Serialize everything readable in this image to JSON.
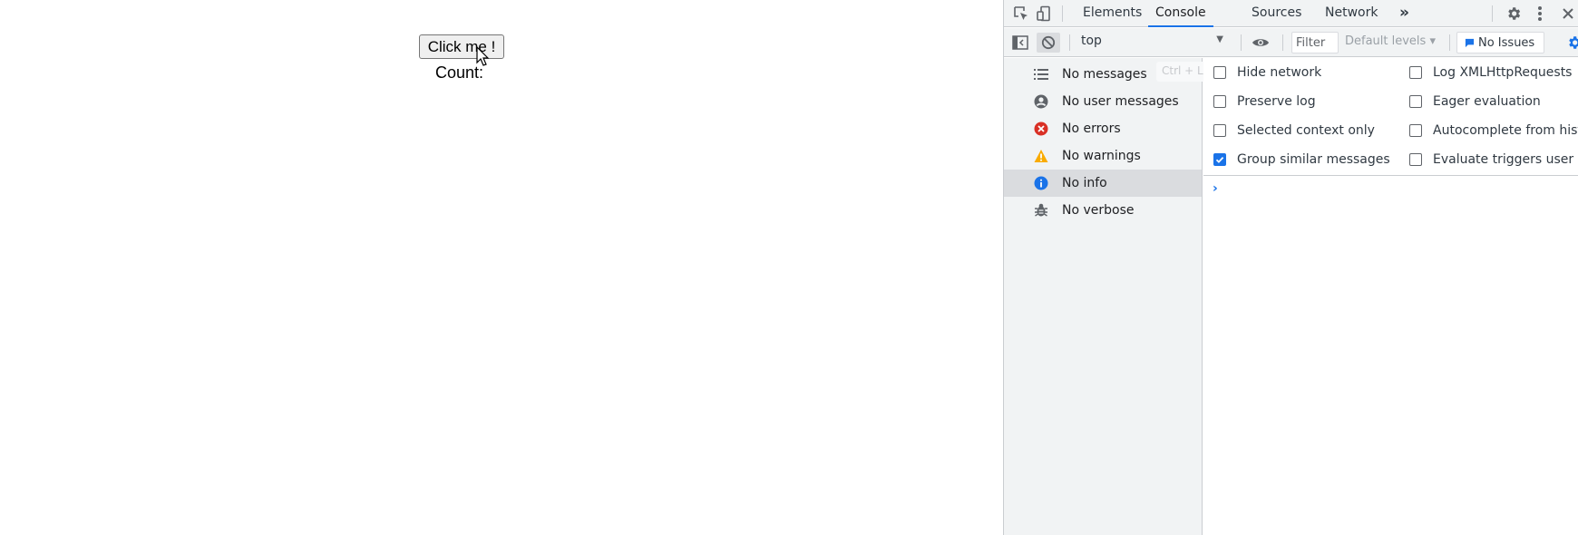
{
  "page": {
    "button_label": "Click me !",
    "count_label": "Count:"
  },
  "devtools": {
    "tabs": [
      {
        "label": "Elements",
        "active": false
      },
      {
        "label": "Console",
        "active": true
      },
      {
        "label": "Sources",
        "active": false
      },
      {
        "label": "Network",
        "active": false
      }
    ],
    "more_tabs_glyph": "»",
    "toolbar": {
      "context": "top",
      "filter_placeholder": "Filter",
      "levels_label": "Default levels ▾",
      "issues_label": "No Issues"
    },
    "sidebar": {
      "clear_shortcut_hint": "Ctrl + L",
      "items": [
        {
          "label": "No messages",
          "icon": "list-icon",
          "selected": false
        },
        {
          "label": "No user messages",
          "icon": "user-icon",
          "selected": false
        },
        {
          "label": "No errors",
          "icon": "error-icon",
          "selected": false
        },
        {
          "label": "No warnings",
          "icon": "warning-icon",
          "selected": false
        },
        {
          "label": "No info",
          "icon": "info-icon",
          "selected": true
        },
        {
          "label": "No verbose",
          "icon": "bug-icon",
          "selected": false
        }
      ]
    },
    "settings": {
      "left": [
        {
          "label": "Hide network",
          "checked": false
        },
        {
          "label": "Preserve log",
          "checked": false
        },
        {
          "label": "Selected context only",
          "checked": false
        },
        {
          "label": "Group similar messages in c",
          "checked": true
        }
      ],
      "right": [
        {
          "label": "Log XMLHttpRequests",
          "checked": false
        },
        {
          "label": "Eager evaluation",
          "checked": false
        },
        {
          "label": "Autocomplete from histo",
          "checked": false
        },
        {
          "label": "Evaluate triggers user act",
          "checked": false
        }
      ]
    },
    "prompt_glyph": "›",
    "colors": {
      "accent": "#1a73e8",
      "error": "#d93025",
      "warning": "#f9ab00",
      "info": "#1a73e8",
      "panel_bg": "#f1f3f4"
    }
  }
}
